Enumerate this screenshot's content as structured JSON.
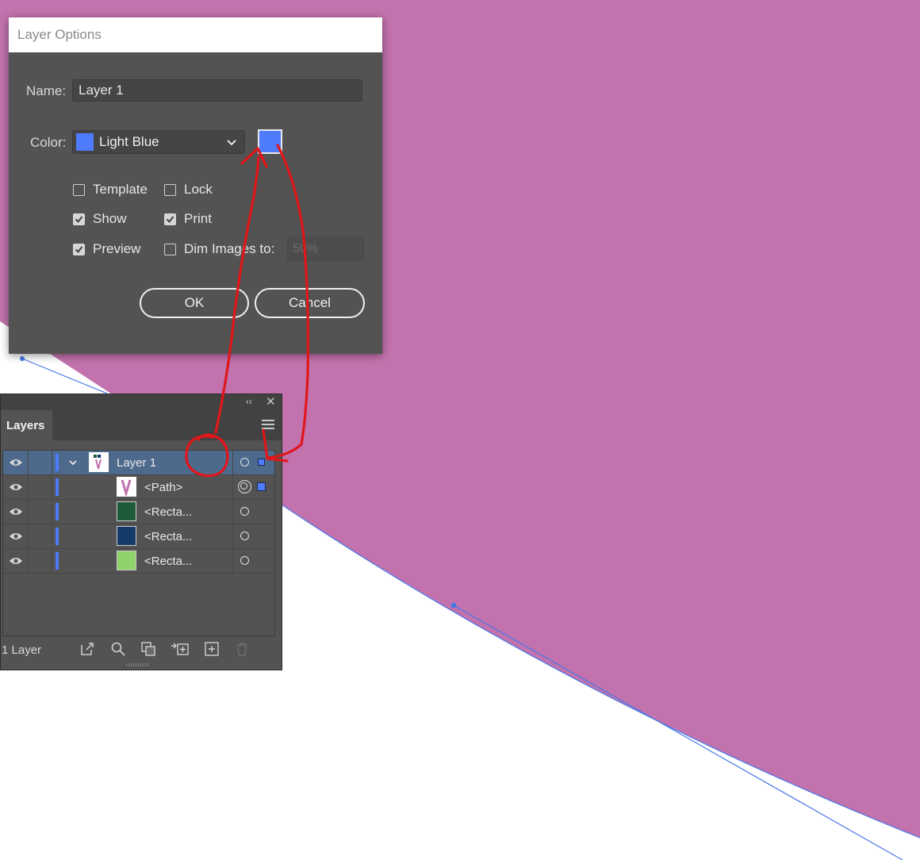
{
  "colors": {
    "artwork_fill": "#c272ad",
    "path_stroke": "#4a78e8",
    "layer_color": "#4f7bff",
    "annotation": "#e0161a",
    "dialog_bg": "#535353"
  },
  "dialog": {
    "title": "Layer Options",
    "name_label": "Name:",
    "name_value": "Layer 1",
    "color_label": "Color:",
    "color_value": "Light Blue",
    "checkboxes": {
      "template": "Template",
      "lock": "Lock",
      "show": "Show",
      "print": "Print",
      "preview": "Preview",
      "dim_images": "Dim Images to:"
    },
    "checked": {
      "template": false,
      "lock": false,
      "show": true,
      "print": true,
      "preview": true,
      "dim_images": false
    },
    "dim_value": "50%",
    "ok_label": "OK",
    "cancel_label": "Cancel"
  },
  "layers_panel": {
    "tab_label": "Layers",
    "footer_count": "1 Layer",
    "rows": [
      {
        "name": "Layer 1",
        "type": "layer",
        "thumb": "layer-thumb",
        "selected": true
      },
      {
        "name": "<Path>",
        "type": "path",
        "thumb": "#c272ad"
      },
      {
        "name": "<Recta...",
        "type": "rect",
        "thumb": "#1f5a3a"
      },
      {
        "name": "<Recta...",
        "type": "rect",
        "thumb": "#143a6a"
      },
      {
        "name": "<Recta...",
        "type": "rect",
        "thumb": "#8fd16a"
      }
    ],
    "footer_icons": [
      "export-icon",
      "search-icon",
      "clipping-mask-icon",
      "move-to-layer-icon",
      "new-layer-icon",
      "trash-icon"
    ]
  }
}
